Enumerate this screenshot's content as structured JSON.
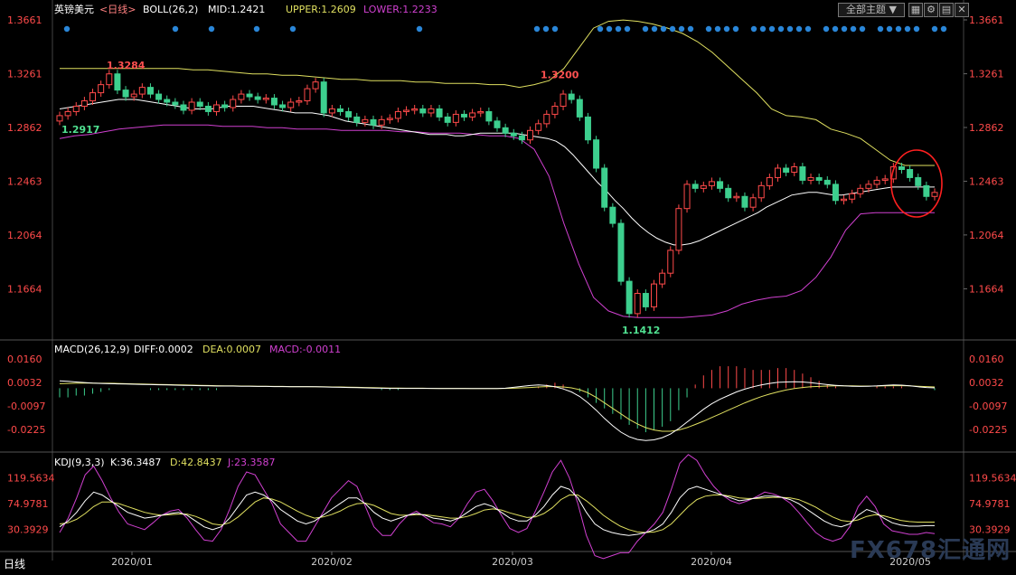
{
  "header": {
    "symbol": "英镑美元",
    "period": "<日线>",
    "boll_label": "BOLL(26,2)",
    "mid": "MID:1.2421",
    "upper": "UPPER:1.2609",
    "lower": "LOWER:1.2233",
    "theme_button": "全部主题",
    "bottom_tab": "日线"
  },
  "colors": {
    "up": "#ff4a4a",
    "down": "#3dcf8e",
    "mid": "#ffffff",
    "upper": "#e0e060",
    "lower": "#d040d0",
    "axis_text": "#ff4a4a",
    "dot": "#2a86d8"
  },
  "macd": {
    "label": "MACD(26,12,9)",
    "diff": "DIFF:0.0002",
    "dea": "DEA:0.0007",
    "macd": "MACD:-0.0011"
  },
  "kdj": {
    "label": "KDJ(9,3,3)",
    "k": "K:36.3487",
    "d": "D:42.8437",
    "j": "J:23.3587"
  },
  "watermark": "FX678汇通网",
  "chart_data": {
    "type": "candlestick",
    "price_axis_ticks": [
      "1.3661",
      "1.3261",
      "1.2862",
      "1.2463",
      "1.2064",
      "1.1664"
    ],
    "price_ylim": [
      1.1412,
      1.3661
    ],
    "macd_axis_ticks": [
      "0.0160",
      "0.0032",
      "-0.0097",
      "-0.0225"
    ],
    "kdj_axis_ticks": [
      "119.5634",
      "74.9781",
      "30.3929"
    ],
    "x_tick_labels": [
      "2020/01",
      "2020/02",
      "2020/03",
      "2020/04",
      "2020/05"
    ],
    "annotations": [
      {
        "text": "1.3284",
        "value": 1.3284
      },
      {
        "text": "1.2917",
        "value": 1.2917
      },
      {
        "text": "1.3200",
        "value": 1.32
      },
      {
        "text": "1.1412",
        "value": 1.1412
      }
    ],
    "close": [
      1.295,
      1.298,
      1.302,
      1.306,
      1.312,
      1.318,
      1.326,
      1.314,
      1.309,
      1.311,
      1.316,
      1.311,
      1.307,
      1.305,
      1.303,
      1.299,
      1.305,
      1.302,
      1.298,
      1.303,
      1.301,
      1.307,
      1.311,
      1.309,
      1.307,
      1.308,
      1.303,
      1.301,
      1.305,
      1.306,
      1.315,
      1.32,
      1.297,
      1.3,
      1.298,
      1.294,
      1.29,
      1.292,
      1.288,
      1.292,
      1.293,
      1.298,
      1.299,
      1.3,
      1.297,
      1.3,
      1.294,
      1.29,
      1.296,
      1.294,
      1.297,
      1.298,
      1.291,
      1.286,
      1.282,
      1.28,
      1.277,
      1.284,
      1.289,
      1.296,
      1.302,
      1.311,
      1.307,
      1.294,
      1.277,
      1.256,
      1.227,
      1.215,
      1.172,
      1.148,
      1.163,
      1.153,
      1.17,
      1.178,
      1.195,
      1.226,
      1.244,
      1.241,
      1.243,
      1.246,
      1.241,
      1.234,
      1.235,
      1.227,
      1.234,
      1.243,
      1.249,
      1.256,
      1.253,
      1.257,
      1.247,
      1.249,
      1.247,
      1.244,
      1.232,
      1.233,
      1.237,
      1.241,
      1.244,
      1.247,
      1.248,
      1.257,
      1.255,
      1.249,
      1.243,
      1.235,
      1.238
    ],
    "open": [
      1.291,
      1.295,
      1.298,
      1.302,
      1.306,
      1.312,
      1.318,
      1.326,
      1.314,
      1.309,
      1.311,
      1.316,
      1.311,
      1.307,
      1.305,
      1.303,
      1.299,
      1.305,
      1.302,
      1.298,
      1.303,
      1.301,
      1.307,
      1.311,
      1.309,
      1.307,
      1.308,
      1.303,
      1.301,
      1.305,
      1.306,
      1.315,
      1.32,
      1.297,
      1.3,
      1.298,
      1.294,
      1.29,
      1.292,
      1.288,
      1.292,
      1.293,
      1.298,
      1.299,
      1.3,
      1.297,
      1.3,
      1.294,
      1.29,
      1.296,
      1.294,
      1.297,
      1.298,
      1.291,
      1.286,
      1.282,
      1.28,
      1.277,
      1.284,
      1.289,
      1.296,
      1.302,
      1.311,
      1.307,
      1.294,
      1.277,
      1.256,
      1.227,
      1.215,
      1.172,
      1.148,
      1.163,
      1.153,
      1.17,
      1.178,
      1.195,
      1.226,
      1.244,
      1.241,
      1.243,
      1.246,
      1.241,
      1.234,
      1.235,
      1.227,
      1.234,
      1.243,
      1.249,
      1.256,
      1.253,
      1.257,
      1.247,
      1.249,
      1.247,
      1.244,
      1.232,
      1.233,
      1.237,
      1.241,
      1.244,
      1.247,
      1.248,
      1.257,
      1.255,
      1.249,
      1.243,
      1.235
    ],
    "mid_line": [
      1.3,
      1.301,
      1.302,
      1.303,
      1.304,
      1.305,
      1.306,
      1.307,
      1.307,
      1.307,
      1.306,
      1.305,
      1.304,
      1.303,
      1.302,
      1.301,
      1.3,
      1.3,
      1.3,
      1.301,
      1.302,
      1.302,
      1.302,
      1.302,
      1.301,
      1.3,
      1.299,
      1.298,
      1.297,
      1.297,
      1.297,
      1.296,
      1.295,
      1.293,
      1.291,
      1.29,
      1.289,
      1.288,
      1.287,
      1.286,
      1.285,
      1.284,
      1.283,
      1.282,
      1.281,
      1.281,
      1.281,
      1.28,
      1.28,
      1.281,
      1.282,
      1.282,
      1.282,
      1.282,
      1.282,
      1.281,
      1.28,
      1.279,
      1.278,
      1.276,
      1.272,
      1.266,
      1.259,
      1.252,
      1.245,
      1.239,
      1.232,
      1.226,
      1.219,
      1.213,
      1.208,
      1.204,
      1.201,
      1.199,
      1.199,
      1.2,
      1.202,
      1.205,
      1.208,
      1.211,
      1.214,
      1.217,
      1.22,
      1.223,
      1.227,
      1.23,
      1.233,
      1.236,
      1.237,
      1.238,
      1.238,
      1.237,
      1.236,
      1.236,
      1.237,
      1.238,
      1.239,
      1.24,
      1.241,
      1.242,
      1.242,
      1.242,
      1.242,
      1.242,
      1.242
    ],
    "upper_line": [
      1.33,
      1.33,
      1.33,
      1.33,
      1.33,
      1.33,
      1.33,
      1.33,
      1.33,
      1.329,
      1.329,
      1.328,
      1.327,
      1.326,
      1.326,
      1.325,
      1.325,
      1.324,
      1.323,
      1.322,
      1.322,
      1.321,
      1.321,
      1.321,
      1.32,
      1.32,
      1.319,
      1.319,
      1.319,
      1.318,
      1.318,
      1.316,
      1.318,
      1.321,
      1.33,
      1.345,
      1.36,
      1.365,
      1.366,
      1.365,
      1.363,
      1.36,
      1.356,
      1.35,
      1.342,
      1.332,
      1.322,
      1.312,
      1.3,
      1.295,
      1.294,
      1.292,
      1.285,
      1.282,
      1.278,
      1.27,
      1.262,
      1.258,
      1.258,
      1.258
    ],
    "lower_line": [
      1.278,
      1.28,
      1.281,
      1.283,
      1.285,
      1.286,
      1.287,
      1.288,
      1.288,
      1.288,
      1.288,
      1.287,
      1.287,
      1.287,
      1.286,
      1.286,
      1.285,
      1.285,
      1.285,
      1.284,
      1.284,
      1.284,
      1.284,
      1.283,
      1.283,
      1.282,
      1.282,
      1.282,
      1.281,
      1.28,
      1.28,
      1.278,
      1.27,
      1.25,
      1.215,
      1.185,
      1.16,
      1.15,
      1.146,
      1.145,
      1.145,
      1.145,
      1.145,
      1.146,
      1.147,
      1.15,
      1.155,
      1.158,
      1.16,
      1.161,
      1.165,
      1.175,
      1.19,
      1.21,
      1.222,
      1.223,
      1.223,
      1.223,
      1.223,
      1.223
    ],
    "macd_hist": [
      -0.005,
      -0.005,
      -0.004,
      -0.004,
      -0.003,
      -0.002,
      -0.001,
      0.0,
      0.0,
      0.0,
      0.0,
      -0.001,
      -0.001,
      -0.001,
      -0.001,
      -0.001,
      -0.001,
      -0.001,
      -0.001,
      -0.001,
      0.0,
      0.0,
      0.0,
      0.0,
      0.0,
      0.0,
      0.0,
      0.0,
      0.0,
      0.0,
      0.0,
      0.0,
      0.0,
      0.0,
      0.0,
      0.0,
      0.0,
      0.0,
      0.0,
      -0.001,
      -0.001,
      -0.001,
      0.0,
      0.0,
      0.0,
      0.0,
      0.0,
      0.0,
      0.0,
      0.0,
      0.0,
      0.0,
      0.0,
      0.0,
      0.0,
      0.0,
      0.0,
      0.0,
      0.001,
      0.002,
      0.003,
      0.002,
      0.0,
      -0.002,
      -0.005,
      -0.008,
      -0.011,
      -0.014,
      -0.017,
      -0.02,
      -0.022,
      -0.024,
      -0.023,
      -0.021,
      -0.018,
      -0.012,
      -0.005,
      0.002,
      0.007,
      0.01,
      0.012,
      0.012,
      0.012,
      0.011,
      0.01,
      0.01,
      0.01,
      0.011,
      0.011,
      0.01,
      0.008,
      0.006,
      0.004,
      0.002,
      0.001,
      0.0,
      0.0,
      0.0,
      0.0,
      0.001,
      0.001,
      0.001,
      0.001,
      0.0,
      0.0,
      0.0,
      -0.001
    ],
    "macd_diff": [
      0.004,
      0.0038,
      0.0034,
      0.0031,
      0.0028,
      0.0026,
      0.0025,
      0.0024,
      0.0023,
      0.0022,
      0.0021,
      0.002,
      0.0019,
      0.0018,
      0.0017,
      0.0016,
      0.0015,
      0.0014,
      0.0013,
      0.0012,
      0.0012,
      0.0012,
      0.0011,
      0.0011,
      0.001,
      0.001,
      0.0009,
      0.0009,
      0.0008,
      0.0008,
      0.0008,
      0.0008,
      0.0007,
      0.0006,
      0.0005,
      0.0004,
      0.0003,
      0.0002,
      0.0001,
      0.0,
      -0.0001,
      -0.0001,
      -0.0001,
      -0.0001,
      -0.0001,
      -0.0001,
      -0.0002,
      -0.0002,
      -0.0002,
      -0.0002,
      -0.0002,
      -0.0002,
      -0.0002,
      -0.0002,
      0.0,
      0.0005,
      0.001,
      0.0015,
      0.0018,
      0.0015,
      0.0008,
      -0.0004,
      -0.002,
      -0.0045,
      -0.008,
      -0.012,
      -0.0165,
      -0.0205,
      -0.024,
      -0.0265,
      -0.028,
      -0.0285,
      -0.0282,
      -0.027,
      -0.025,
      -0.022,
      -0.0185,
      -0.015,
      -0.0115,
      -0.0085,
      -0.006,
      -0.004,
      -0.002,
      -0.0005,
      0.0008,
      0.0018,
      0.0026,
      0.0032,
      0.0034,
      0.0035,
      0.0034,
      0.003,
      0.0025,
      0.002,
      0.0016,
      0.0013,
      0.0011,
      0.001,
      0.0011,
      0.0013,
      0.0016,
      0.0018,
      0.0017,
      0.0013,
      0.0008,
      0.0004,
      0.0002
    ],
    "macd_dea": [
      0.0025,
      0.0026,
      0.0027,
      0.0028,
      0.0028,
      0.0027,
      0.0027,
      0.0026,
      0.0025,
      0.0024,
      0.0023,
      0.0022,
      0.0021,
      0.002,
      0.0019,
      0.0018,
      0.0017,
      0.0016,
      0.0015,
      0.0014,
      0.0013,
      0.0013,
      0.0012,
      0.0012,
      0.0011,
      0.0011,
      0.001,
      0.001,
      0.0009,
      0.0009,
      0.0009,
      0.0008,
      0.0008,
      0.0007,
      0.0007,
      0.0006,
      0.0005,
      0.0004,
      0.0003,
      0.0002,
      0.0001,
      0.0001,
      0.0,
      0.0,
      0.0,
      -0.0001,
      -0.0001,
      -0.0001,
      -0.0001,
      -0.0001,
      -0.0002,
      -0.0002,
      -0.0002,
      -0.0002,
      -0.0001,
      0.0,
      0.0002,
      0.0004,
      0.0007,
      0.0009,
      0.0009,
      0.0007,
      0.0002,
      -0.0008,
      -0.0025,
      -0.005,
      -0.008,
      -0.011,
      -0.014,
      -0.017,
      -0.0195,
      -0.0215,
      -0.0228,
      -0.0235,
      -0.0235,
      -0.0228,
      -0.0215,
      -0.0198,
      -0.018,
      -0.016,
      -0.014,
      -0.012,
      -0.01,
      -0.008,
      -0.0062,
      -0.0046,
      -0.0032,
      -0.002,
      -0.001,
      -0.0002,
      0.0004,
      0.0008,
      0.001,
      0.0012,
      0.0013,
      0.0013,
      0.0013,
      0.0012,
      0.0012,
      0.0012,
      0.0013,
      0.0014,
      0.0014,
      0.0013,
      0.0011,
      0.0009,
      0.0007
    ],
    "kdj_k": [
      35,
      45,
      60,
      80,
      95,
      90,
      80,
      70,
      60,
      55,
      50,
      52,
      55,
      58,
      60,
      55,
      45,
      35,
      30,
      35,
      50,
      70,
      90,
      95,
      90,
      80,
      65,
      55,
      45,
      40,
      45,
      55,
      65,
      75,
      85,
      85,
      75,
      60,
      50,
      45,
      50,
      55,
      58,
      55,
      50,
      48,
      45,
      50,
      60,
      70,
      75,
      70,
      60,
      50,
      45,
      45,
      55,
      70,
      90,
      105,
      100,
      85,
      60,
      40,
      30,
      25,
      22,
      20,
      22,
      25,
      30,
      40,
      60,
      85,
      100,
      105,
      100,
      95,
      90,
      85,
      80,
      82,
      85,
      88,
      88,
      86,
      82,
      75,
      65,
      55,
      45,
      38,
      35,
      40,
      55,
      65,
      60,
      50,
      42,
      38,
      36,
      36,
      37,
      37
    ],
    "kdj_d": [
      40,
      42,
      48,
      58,
      70,
      78,
      78,
      75,
      70,
      65,
      60,
      57,
      55,
      56,
      57,
      57,
      53,
      47,
      40,
      38,
      42,
      52,
      65,
      78,
      85,
      83,
      78,
      70,
      62,
      55,
      50,
      52,
      56,
      62,
      70,
      75,
      76,
      72,
      65,
      58,
      55,
      55,
      56,
      56,
      54,
      52,
      50,
      50,
      53,
      58,
      64,
      66,
      64,
      59,
      55,
      51,
      52,
      58,
      68,
      82,
      90,
      90,
      80,
      68,
      55,
      45,
      36,
      30,
      26,
      25,
      26,
      30,
      40,
      55,
      70,
      82,
      88,
      90,
      90,
      88,
      85,
      84,
      84,
      85,
      86,
      86,
      85,
      82,
      76,
      69,
      60,
      52,
      46,
      44,
      47,
      53,
      56,
      54,
      50,
      46,
      44,
      43,
      43,
      43
    ],
    "kdj_j": [
      25,
      50,
      85,
      125,
      140,
      115,
      85,
      60,
      40,
      35,
      30,
      42,
      55,
      62,
      65,
      50,
      30,
      12,
      10,
      30,
      65,
      105,
      130,
      125,
      100,
      75,
      40,
      25,
      10,
      10,
      35,
      60,
      85,
      100,
      115,
      105,
      70,
      35,
      20,
      20,
      40,
      55,
      62,
      52,
      42,
      40,
      35,
      50,
      75,
      95,
      100,
      80,
      55,
      32,
      25,
      32,
      62,
      95,
      130,
      150,
      120,
      75,
      20,
      -15,
      -20,
      -15,
      -10,
      -10,
      10,
      25,
      40,
      60,
      100,
      145,
      160,
      150,
      125,
      105,
      90,
      80,
      75,
      80,
      87,
      95,
      92,
      86,
      76,
      60,
      42,
      25,
      15,
      10,
      15,
      35,
      70,
      88,
      70,
      40,
      28,
      25,
      22,
      22,
      25,
      23
    ]
  }
}
